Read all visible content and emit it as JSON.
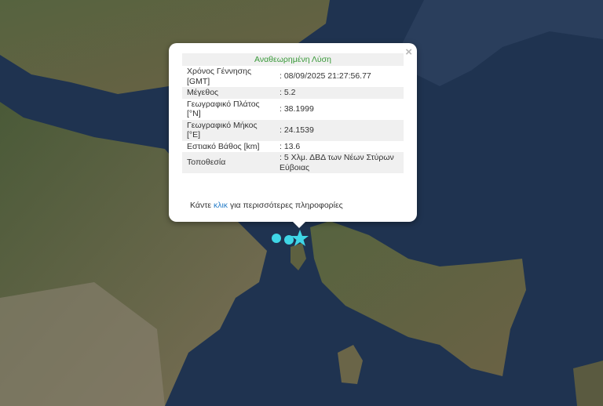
{
  "popup": {
    "title": "Αναθεωρημένη Λύση",
    "close_label": "×",
    "rows": [
      {
        "label": "Χρόνος Γέννησης [GMT]",
        "value": ": 08/09/2025 21:27:56.77"
      },
      {
        "label": "Μέγεθος",
        "value": ": 5.2"
      },
      {
        "label": "Γεωγραφικό Πλάτος [°N]",
        "value": ": 38.1999"
      },
      {
        "label": "Γεωγραφικό Μήκος [°E]",
        "value": ": 24.1539"
      },
      {
        "label": "Εστιακό Βάθος [km]",
        "value": ": 13.6"
      },
      {
        "label": "Τοποθεσία",
        "value": ": 5 Χλμ. ΔΒΔ των Νέων Στύρων Εύβοιας"
      }
    ],
    "more_prefix": "Κάντε ",
    "more_link": "κλικ",
    "more_suffix": " για περισσότερες πληροφορίες"
  },
  "colors": {
    "sea": "#1f3350",
    "land": "#4d5a3c",
    "marker": "#3fd6e6"
  }
}
